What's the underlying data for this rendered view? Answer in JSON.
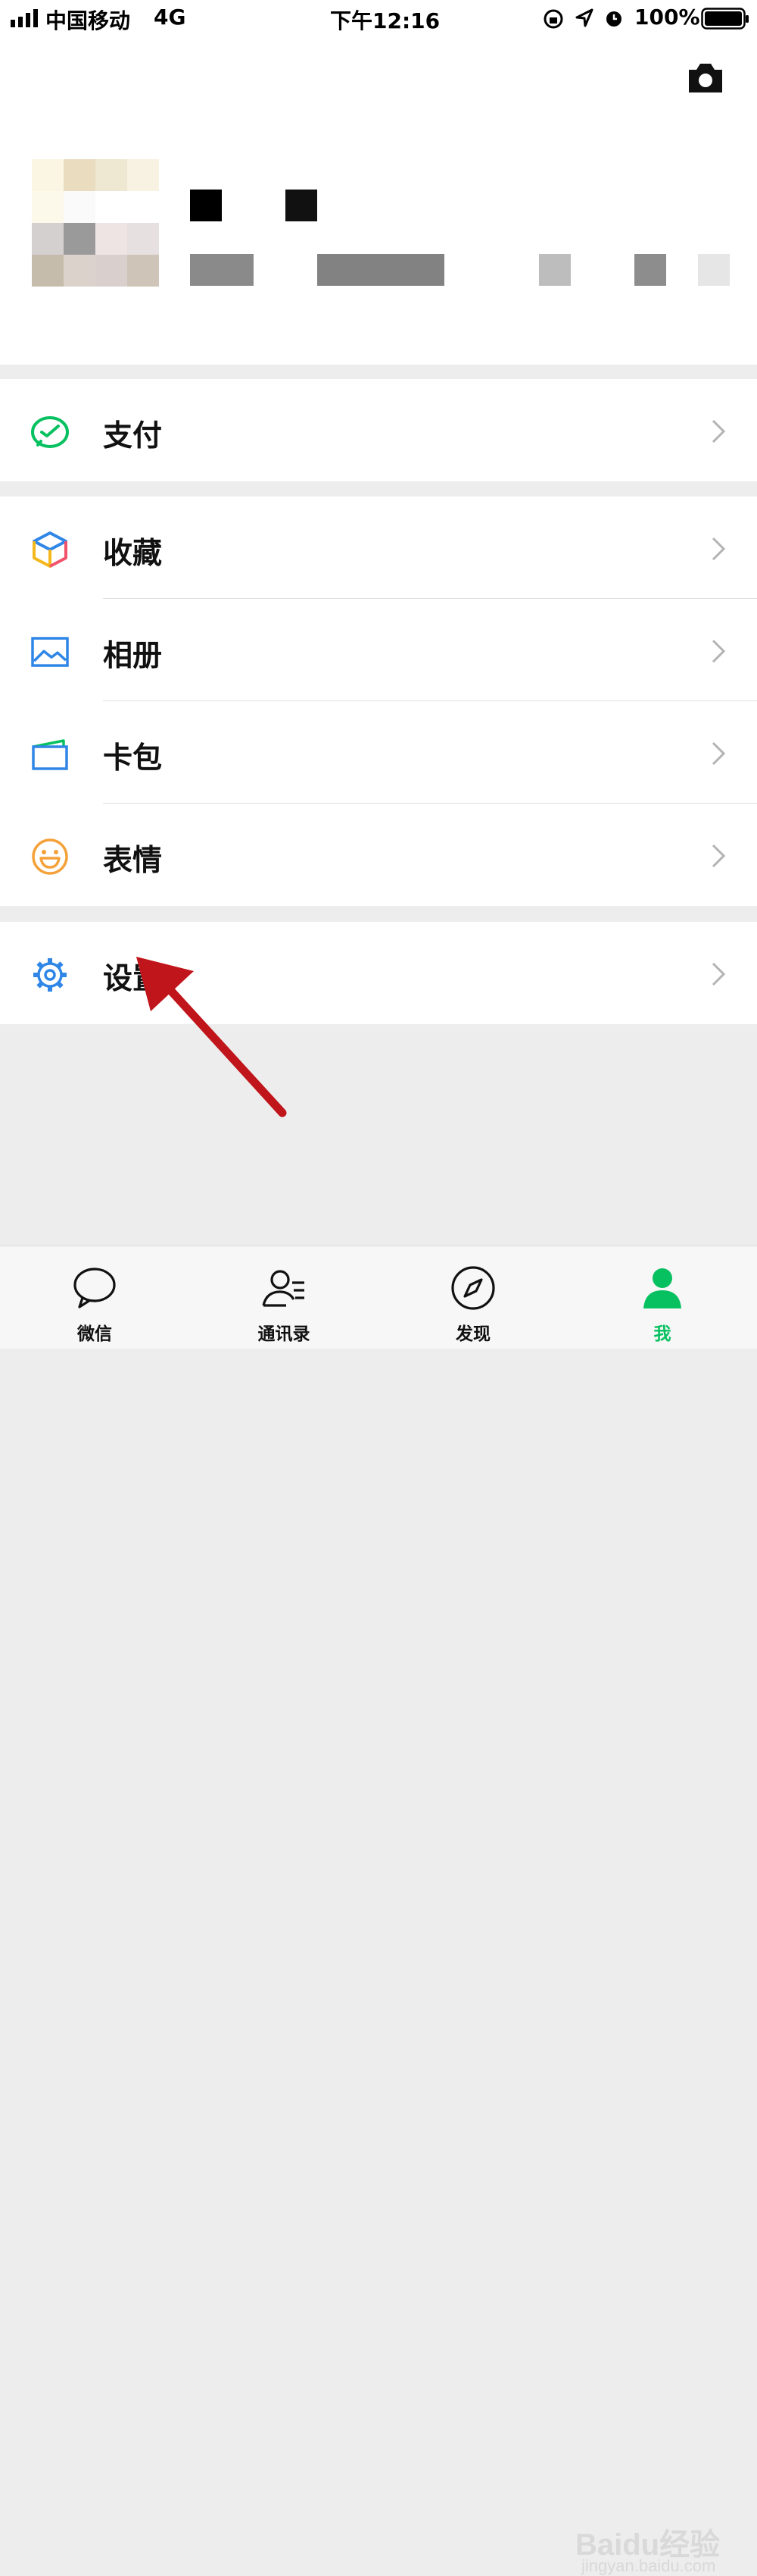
{
  "status_bar": {
    "carrier": "中国移动",
    "network": "4G",
    "time": "下午12:16",
    "battery": "100%"
  },
  "menu": {
    "pay": "支付",
    "favorites": "收藏",
    "album": "相册",
    "cards": "卡包",
    "stickers": "表情",
    "settings": "设置"
  },
  "tabs": [
    {
      "label": "微信"
    },
    {
      "label": "通讯录"
    },
    {
      "label": "发现"
    },
    {
      "label": "我"
    }
  ],
  "colors": {
    "accent": "#07c160",
    "arrow": "#c0151a"
  },
  "watermark": {
    "brand": "Baidu经验",
    "url": "jingyan.baidu.com"
  }
}
